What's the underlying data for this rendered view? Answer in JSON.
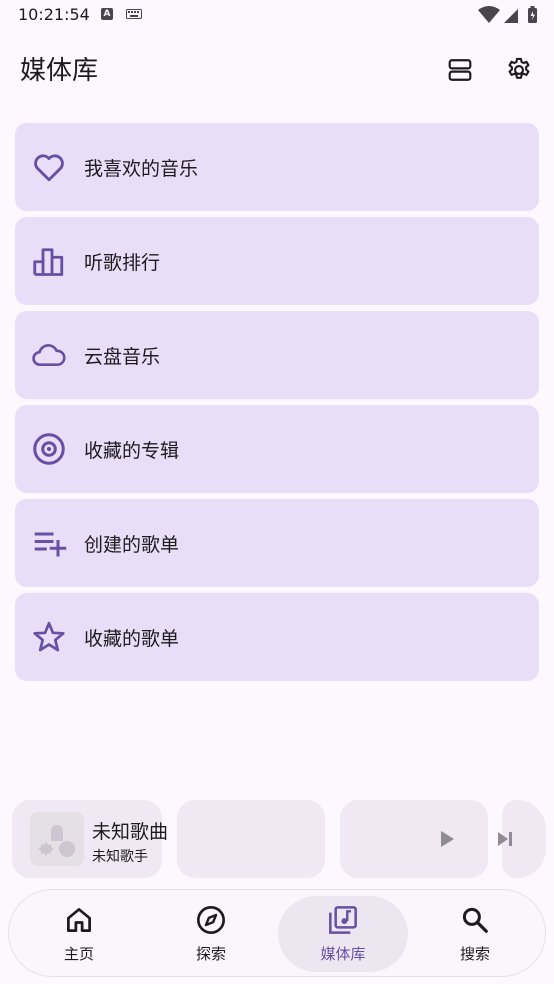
{
  "status_bar": {
    "time": "10:21:54",
    "indicator_a": "A"
  },
  "header": {
    "title": "媒体库",
    "layout_button_icon": "view-agenda-icon",
    "settings_button_icon": "gear-icon"
  },
  "library": {
    "items": [
      {
        "label": "我喜欢的音乐",
        "icon": "heart-icon"
      },
      {
        "label": "听歌排行",
        "icon": "ranking-bars-icon"
      },
      {
        "label": "云盘音乐",
        "icon": "cloud-icon"
      },
      {
        "label": "收藏的专辑",
        "icon": "album-disc-icon"
      },
      {
        "label": "创建的歌单",
        "icon": "playlist-add-icon"
      },
      {
        "label": "收藏的歌单",
        "icon": "star-icon"
      }
    ]
  },
  "mini_player": {
    "title": "未知歌曲",
    "artist": "未知歌手"
  },
  "bottom_nav": {
    "items": [
      {
        "label": "主页",
        "icon": "home-icon"
      },
      {
        "label": "探索",
        "icon": "compass-icon"
      },
      {
        "label": "媒体库",
        "icon": "library-music-icon",
        "active": true
      },
      {
        "label": "搜索",
        "icon": "search-icon"
      }
    ]
  },
  "colors": {
    "accent": "#6750a4",
    "card": "#e8def8",
    "background": "#fdf7fe"
  }
}
